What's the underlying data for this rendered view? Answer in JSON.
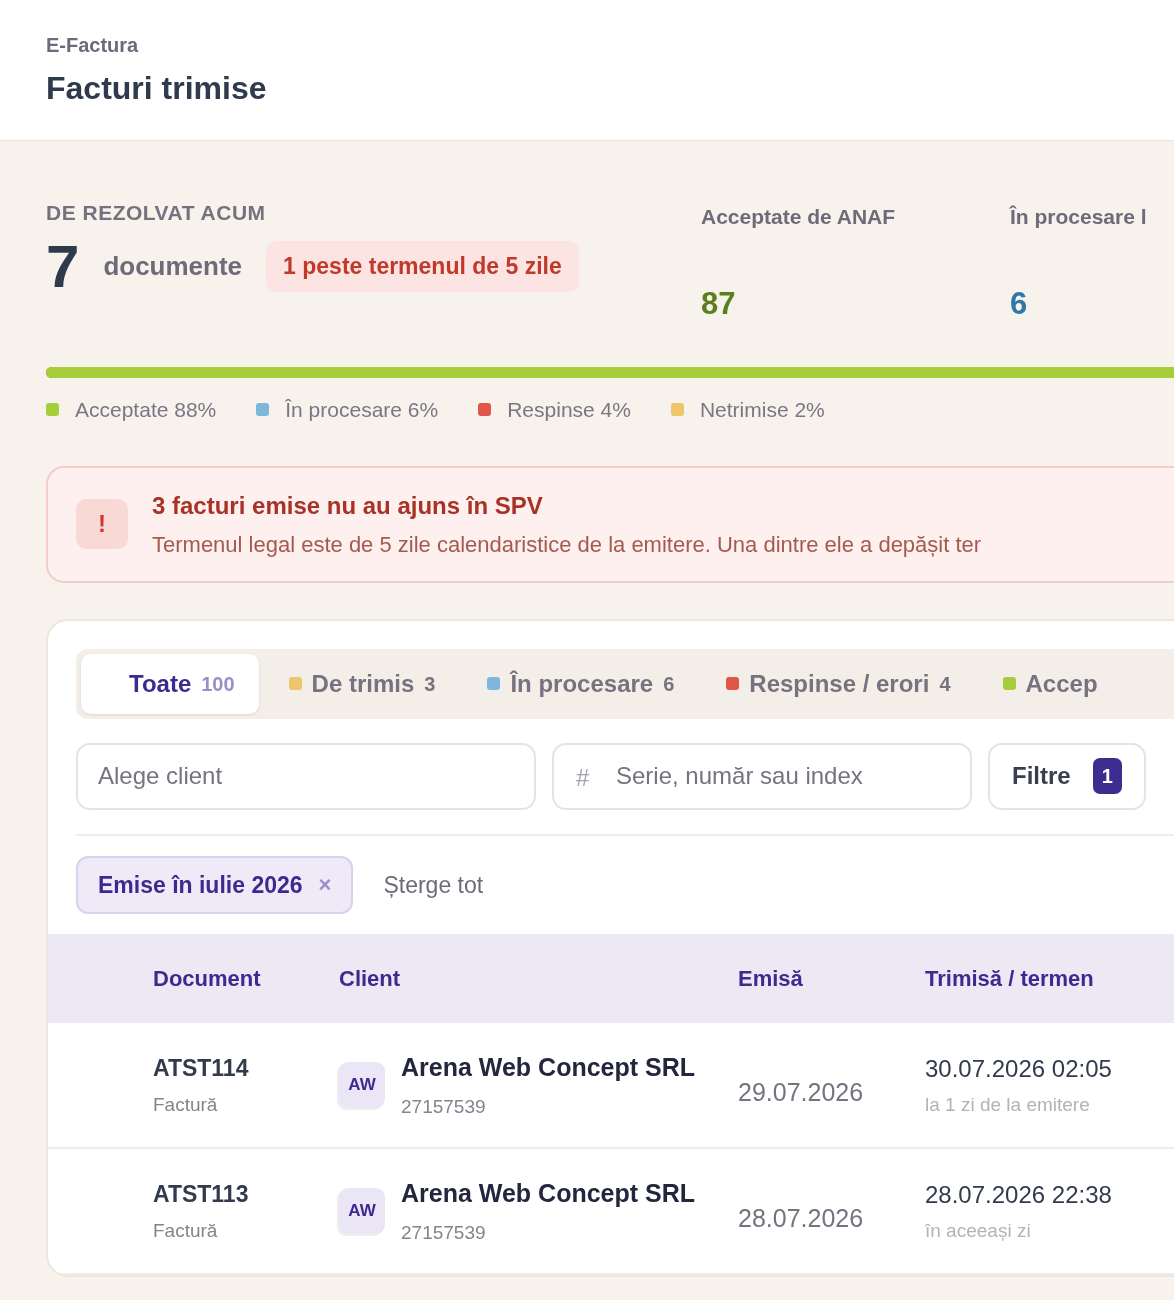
{
  "header": {
    "breadcrumb": "E-Factura",
    "title": "Facturi trimise"
  },
  "summary": {
    "label": "DE REZOLVAT ACUM",
    "count": "7",
    "unit": "documente",
    "warning": "1 peste termenul de 5 zile"
  },
  "stats": [
    {
      "label": "Acceptate de ANAF",
      "value": "87",
      "color": "#5a7f1c"
    },
    {
      "label": "În procesare l",
      "value": "6",
      "color": "#2f78a8"
    }
  ],
  "progress": {
    "level": 0.88
  },
  "legend": [
    {
      "label": "Acceptate 88%",
      "color": "#a6cd3a"
    },
    {
      "label": "În procesare 6%",
      "color": "#7fb6dc"
    },
    {
      "label": "Respinse 4%",
      "color": "#e0574a"
    },
    {
      "label": "Netrimise 2%",
      "color": "#eec56a"
    }
  ],
  "alert": {
    "icon": "!",
    "title": "3 facturi emise nu au ajuns în SPV",
    "text": "Termenul legal este de 5 zile calendaristice de la emitere. Una dintre ele a depășit ter"
  },
  "tabs": [
    {
      "label": "Toate",
      "count": "100",
      "selected": true
    },
    {
      "label": "De trimis",
      "count": "3",
      "color": "#eec56a",
      "selected": false
    },
    {
      "label": "În procesare",
      "count": "6",
      "color": "#7fb6dc",
      "selected": false
    },
    {
      "label": "Respinse / erori",
      "count": "4",
      "color": "#e0574a",
      "selected": false
    },
    {
      "label": "Accep",
      "color": "#a6cd3a",
      "selected": false
    }
  ],
  "filters": {
    "client_placeholder": "Alege client",
    "search_icon": "#",
    "search_placeholder": "Serie, număr sau index",
    "button": "Filtre",
    "button_count": "1"
  },
  "active_filters": {
    "chips": [
      {
        "label": "Emise în iulie 2026",
        "remove": "×"
      }
    ],
    "clear": "Șterge tot"
  },
  "table": {
    "columns": [
      "Document",
      "Client",
      "Emisă",
      "Trimisă / termen"
    ],
    "rows": [
      {
        "number": "ATST114",
        "type": "Factură",
        "initials": "AW",
        "client": "Arena Web Concept SRL",
        "cui": "27157539",
        "issued": "29.07.2026",
        "sent": "30.07.2026 02:05",
        "note": "la 1 zi de la emitere"
      },
      {
        "number": "ATST113",
        "type": "Factură",
        "initials": "AW",
        "client": "Arena Web Concept SRL",
        "cui": "27157539",
        "issued": "28.07.2026",
        "sent": "28.07.2026 22:38",
        "note": "în aceeași zi"
      }
    ]
  }
}
